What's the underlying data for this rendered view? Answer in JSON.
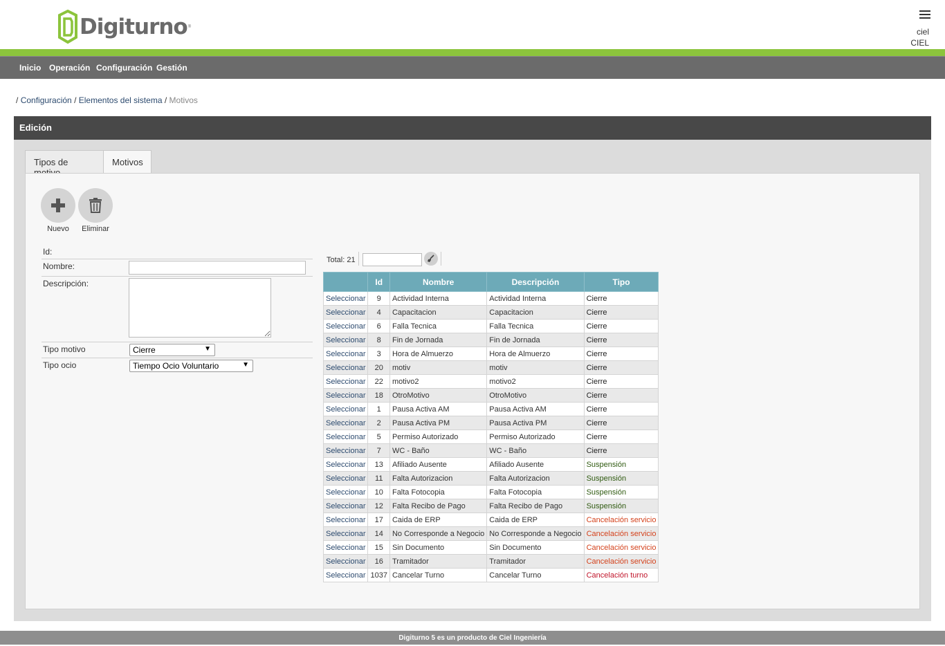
{
  "brand": {
    "name": "Digiturno",
    "reg_mark": "®",
    "green": "#8cc43c"
  },
  "user": {
    "login": "ciel",
    "company": "CIEL"
  },
  "nav": {
    "items": [
      "Inicio",
      "Operación",
      "Configuración",
      "Gestión"
    ]
  },
  "breadcrumb": {
    "sep": "/",
    "items": [
      "Configuración",
      "Elementos del sistema"
    ],
    "current": "Motivos"
  },
  "panel": {
    "title": "Edición"
  },
  "tabs": [
    {
      "label": "Tipos de motivo",
      "active": false
    },
    {
      "label": "Motivos",
      "active": true
    }
  ],
  "actions": {
    "new_label": "Nuevo",
    "delete_label": "Eliminar"
  },
  "form": {
    "id_label": "Id:",
    "name_label": "Nombre:",
    "name_value": "",
    "desc_label": "Descripción:",
    "desc_value": "",
    "tipo_motivo_label": "Tipo motivo",
    "tipo_motivo_value": "Cierre",
    "tipo_ocio_label": "Tipo ocio",
    "tipo_ocio_value": "Tiempo Ocio Voluntario"
  },
  "grid": {
    "total_label": "Total:",
    "total_value": "21",
    "filter_value": "",
    "select_label": "Seleccionar",
    "columns": [
      "",
      "Id",
      "Nombre",
      "Descripción",
      "Tipo"
    ],
    "type_colors": {
      "Cierre": "#222222",
      "Suspensión": "#2f5a10",
      "Cancelación servicio": "#d4421c",
      "Cancelación turno": "#c0142a"
    },
    "rows": [
      {
        "id": "9",
        "nombre": "Actividad Interna",
        "descripcion": "Actividad Interna",
        "tipo": "Cierre"
      },
      {
        "id": "4",
        "nombre": "Capacitacion",
        "descripcion": "Capacitacion",
        "tipo": "Cierre"
      },
      {
        "id": "6",
        "nombre": "Falla Tecnica",
        "descripcion": "Falla Tecnica",
        "tipo": "Cierre"
      },
      {
        "id": "8",
        "nombre": "Fin de Jornada",
        "descripcion": "Fin de Jornada",
        "tipo": "Cierre"
      },
      {
        "id": "3",
        "nombre": "Hora de Almuerzo",
        "descripcion": "Hora de Almuerzo",
        "tipo": "Cierre"
      },
      {
        "id": "20",
        "nombre": "motiv",
        "descripcion": "motiv",
        "tipo": "Cierre"
      },
      {
        "id": "22",
        "nombre": "motivo2",
        "descripcion": "motivo2",
        "tipo": "Cierre"
      },
      {
        "id": "18",
        "nombre": "OtroMotivo",
        "descripcion": "OtroMotivo",
        "tipo": "Cierre"
      },
      {
        "id": "1",
        "nombre": "Pausa Activa AM",
        "descripcion": "Pausa Activa AM",
        "tipo": "Cierre"
      },
      {
        "id": "2",
        "nombre": "Pausa Activa PM",
        "descripcion": "Pausa Activa PM",
        "tipo": "Cierre"
      },
      {
        "id": "5",
        "nombre": "Permiso Autorizado",
        "descripcion": "Permiso Autorizado",
        "tipo": "Cierre"
      },
      {
        "id": "7",
        "nombre": "WC - Baño",
        "descripcion": "WC - Baño",
        "tipo": "Cierre"
      },
      {
        "id": "13",
        "nombre": "Afiliado Ausente",
        "descripcion": "Afiliado Ausente",
        "tipo": "Suspensión"
      },
      {
        "id": "11",
        "nombre": "Falta Autorizacion",
        "descripcion": "Falta Autorizacion",
        "tipo": "Suspensión"
      },
      {
        "id": "10",
        "nombre": "Falta Fotocopia",
        "descripcion": "Falta Fotocopia",
        "tipo": "Suspensión"
      },
      {
        "id": "12",
        "nombre": "Falta Recibo de Pago",
        "descripcion": "Falta Recibo de Pago",
        "tipo": "Suspensión"
      },
      {
        "id": "17",
        "nombre": "Caida de ERP",
        "descripcion": "Caida de ERP",
        "tipo": "Cancelación servicio"
      },
      {
        "id": "14",
        "nombre": "No Corresponde a Negocio",
        "descripcion": "No Corresponde a Negocio",
        "tipo": "Cancelación servicio"
      },
      {
        "id": "15",
        "nombre": "Sin Documento",
        "descripcion": "Sin Documento",
        "tipo": "Cancelación servicio"
      },
      {
        "id": "16",
        "nombre": "Tramitador",
        "descripcion": "Tramitador",
        "tipo": "Cancelación servicio"
      },
      {
        "id": "1037",
        "nombre": "Cancelar Turno",
        "descripcion": "Cancelar Turno",
        "tipo": "Cancelación turno"
      }
    ]
  },
  "footer": {
    "text": "Digiturno 5 es un producto de Ciel Ingeniería"
  }
}
